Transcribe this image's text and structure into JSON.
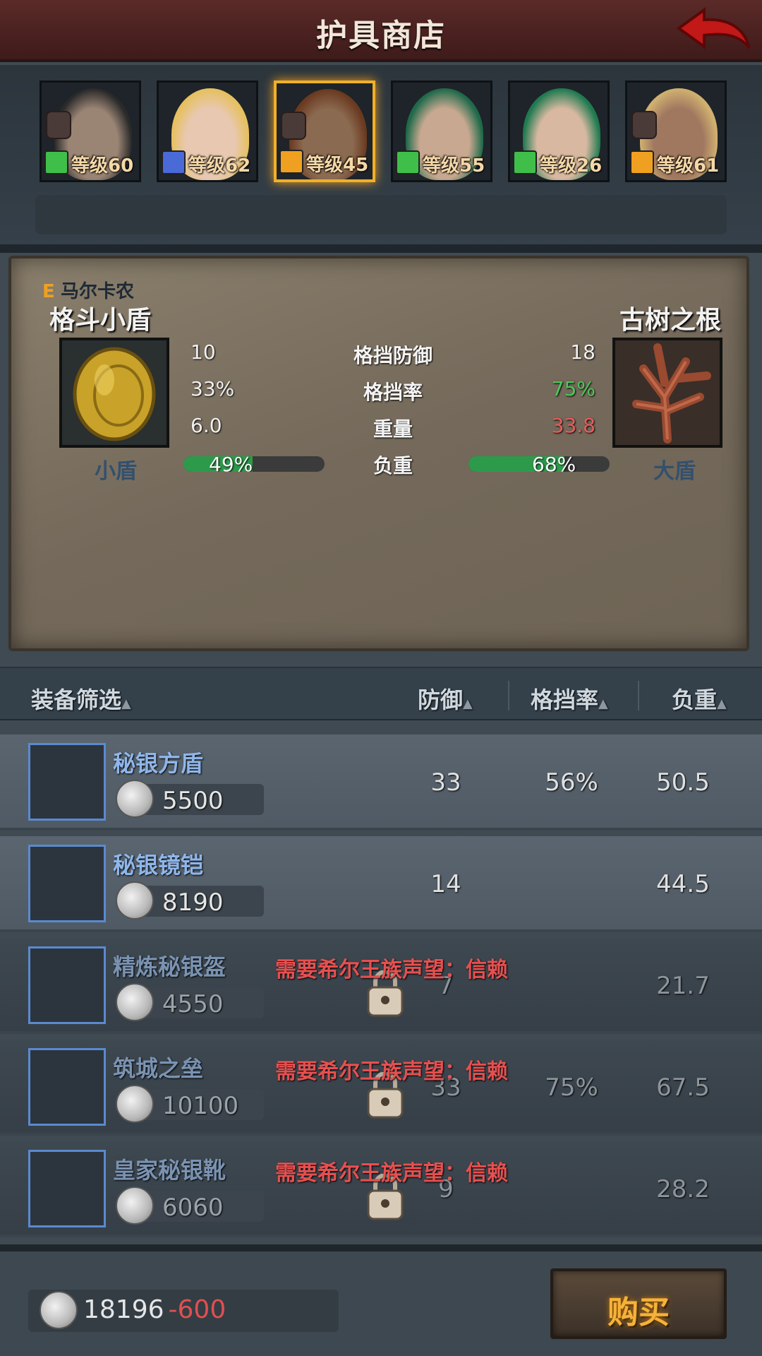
{
  "header": {
    "title": "护具商店"
  },
  "characters": [
    {
      "level": "等级60",
      "class_color": "#3fbf4a",
      "skin": "#9a8474",
      "hair": "#2a2a2a",
      "locked": true
    },
    {
      "level": "等级62",
      "class_color": "#4a6ad8",
      "skin": "#e8c8b0",
      "hair": "#e6c060",
      "locked": false
    },
    {
      "level": "等级45",
      "class_color": "#f0a020",
      "skin": "#8a6a50",
      "hair": "#6a3a20",
      "locked": true,
      "selected": true
    },
    {
      "level": "等级55",
      "class_color": "#3fbf4a",
      "skin": "#c8a890",
      "hair": "#1f6a4a",
      "locked": false
    },
    {
      "level": "等级26",
      "class_color": "#3fbf4a",
      "skin": "#d8b8a0",
      "hair": "#1f7a50",
      "locked": false
    },
    {
      "level": "等级61",
      "class_color": "#f0a020",
      "skin": "#a07860",
      "hair": "#d0b070",
      "locked": true
    }
  ],
  "compare": {
    "owner_rank": "E",
    "owner_name": "马尔卡农",
    "left": {
      "name": "格斗小盾",
      "type": "小盾"
    },
    "right": {
      "name": "古树之根",
      "type": "大盾"
    },
    "stats": [
      {
        "label": "格挡防御",
        "left": "10",
        "right": "18",
        "right_color": "#f0f0f0"
      },
      {
        "label": "格挡率",
        "left": "33%",
        "right": "75%",
        "right_color": "#4cc85a"
      },
      {
        "label": "重量",
        "left": "6.0",
        "right": "33.8",
        "right_color": "#e85c5c"
      }
    ],
    "load": {
      "label": "负重",
      "left_value": "49%",
      "left_fill": 0.49,
      "right_value": "68%",
      "right_fill": 0.68
    }
  },
  "columns": {
    "filter": "装备筛选",
    "defense": "防御",
    "block": "格挡率",
    "weight": "负重"
  },
  "items": [
    {
      "name": "秘银方盾",
      "price": "5500",
      "defense": "33",
      "block": "56%",
      "weight": "50.5",
      "locked": false,
      "requirement": ""
    },
    {
      "name": "秘银镜铠",
      "price": "8190",
      "defense": "14",
      "block": "",
      "weight": "44.5",
      "locked": false,
      "requirement": ""
    },
    {
      "name": "精炼秘银盔",
      "price": "4550",
      "defense": "7",
      "block": "",
      "weight": "21.7",
      "locked": true,
      "requirement": "需要希尔王族声望：信赖"
    },
    {
      "name": "筑城之垒",
      "price": "10100",
      "defense": "33",
      "block": "75%",
      "weight": "67.5",
      "locked": true,
      "requirement": "需要希尔王族声望：信赖"
    },
    {
      "name": "皇家秘银靴",
      "price": "6060",
      "defense": "9",
      "block": "",
      "weight": "28.2",
      "locked": true,
      "requirement": "需要希尔王族声望：信赖"
    }
  ],
  "footer": {
    "money": "18196",
    "cost": "-600",
    "buy_label": "购买"
  }
}
